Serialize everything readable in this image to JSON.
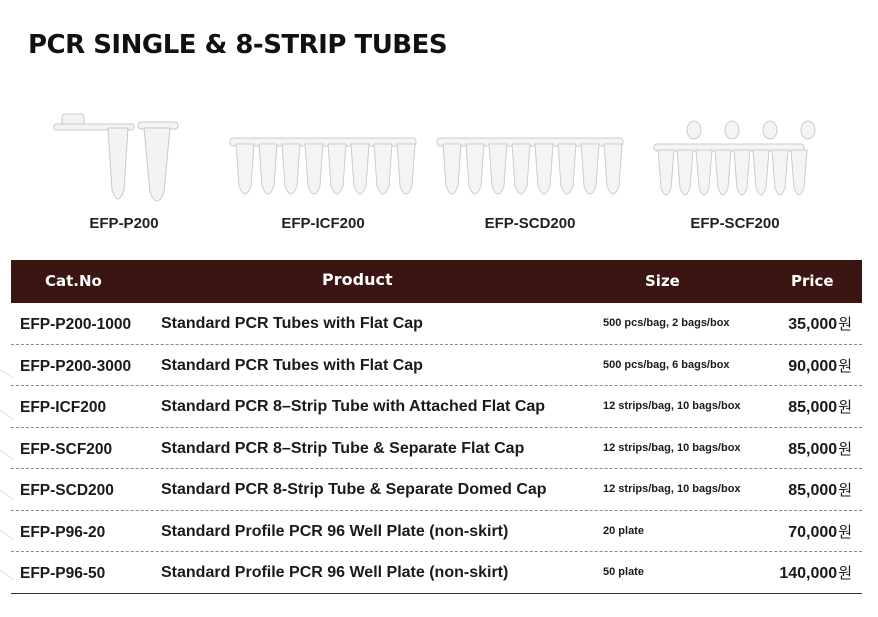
{
  "title": "PCR SINGLE & 8-STRIP TUBES",
  "products": [
    {
      "label": "EFP-P200",
      "icon": "single-tubes-image"
    },
    {
      "label": "EFP-ICF200",
      "icon": "8-strip-tubes-image"
    },
    {
      "label": "EFP-SCD200",
      "icon": "8-strip-domed-tubes-image"
    },
    {
      "label": "EFP-SCF200",
      "icon": "8-strip-caps-image"
    }
  ],
  "table": {
    "headers": {
      "cat": "Cat.No",
      "product": "Product",
      "size": "Size",
      "price": "Price"
    },
    "currency": "원",
    "rows": [
      {
        "cat": "EFP-P200-1000",
        "product": "Standard PCR Tubes with Flat Cap",
        "size": "500 pcs/bag, 2 bags/box",
        "price": "35,000"
      },
      {
        "cat": "EFP-P200-3000",
        "product": "Standard PCR Tubes with Flat Cap",
        "size": "500 pcs/bag, 6 bags/box",
        "price": "90,000"
      },
      {
        "cat": "EFP-ICF200",
        "product": "Standard PCR 8–Strip Tube with Attached Flat Cap",
        "size": "12 strips/bag, 10 bags/box",
        "price": "85,000"
      },
      {
        "cat": "EFP-SCF200",
        "product": "Standard PCR 8–Strip Tube & Separate Flat Cap",
        "size": "12 strips/bag, 10 bags/box",
        "price": "85,000"
      },
      {
        "cat": "EFP-SCD200",
        "product": "Standard PCR 8-Strip Tube & Separate Domed Cap",
        "size": "12 strips/bag, 10 bags/box",
        "price": "85,000"
      },
      {
        "cat": "EFP-P96-20",
        "product": "Standard Profile PCR 96 Well Plate (non-skirt)",
        "size": "20 plate",
        "price": "70,000"
      },
      {
        "cat": "EFP-P96-50",
        "product": "Standard Profile PCR 96 Well Plate (non-skirt)",
        "size": "50 plate",
        "price": "140,000"
      }
    ]
  },
  "colors": {
    "header_bg": "#3a1512",
    "header_text": "#ffffff",
    "text": "#1a1a1a"
  }
}
